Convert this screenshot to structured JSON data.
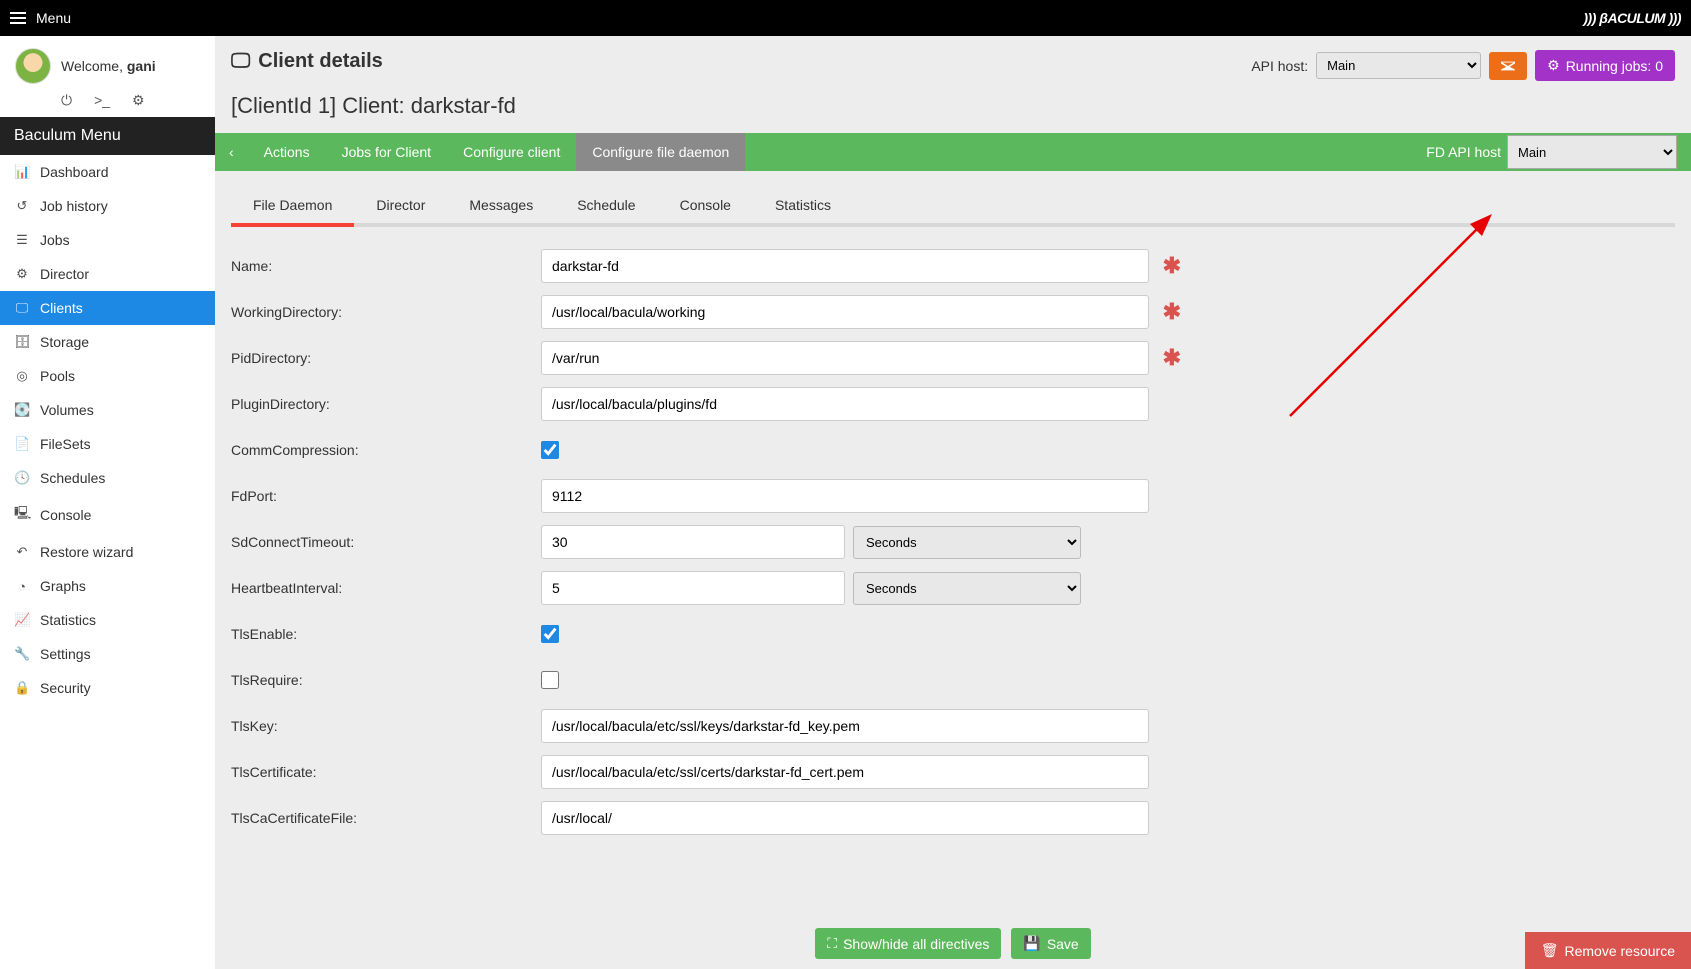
{
  "topbar": {
    "menu": "Menu",
    "brand": "))) βACULUM )))"
  },
  "user": {
    "welcome": "Welcome, ",
    "name": "gani"
  },
  "sidebar": {
    "header": "Baculum Menu",
    "items": [
      {
        "icon": "tach",
        "label": "Dashboard"
      },
      {
        "icon": "hist",
        "label": "Job history"
      },
      {
        "icon": "list",
        "label": "Jobs"
      },
      {
        "icon": "sitemap",
        "label": "Director"
      },
      {
        "icon": "desktop",
        "label": "Clients"
      },
      {
        "icon": "db",
        "label": "Storage"
      },
      {
        "icon": "tape",
        "label": "Pools"
      },
      {
        "icon": "hdd",
        "label": "Volumes"
      },
      {
        "icon": "file",
        "label": "FileSets"
      },
      {
        "icon": "clock",
        "label": "Schedules"
      },
      {
        "icon": "term",
        "label": "Console"
      },
      {
        "icon": "undo",
        "label": "Restore wizard"
      },
      {
        "icon": "pie",
        "label": "Graphs"
      },
      {
        "icon": "chart",
        "label": "Statistics"
      },
      {
        "icon": "wrench",
        "label": "Settings"
      },
      {
        "icon": "lock",
        "label": "Security"
      }
    ]
  },
  "header": {
    "title": "Client details",
    "api_host_label": "API host:",
    "api_host_value": "Main",
    "running_jobs_label": "Running jobs: ",
    "running_jobs_count": "0",
    "subtitle": "[ClientId 1] Client: darkstar-fd"
  },
  "tabs": {
    "items": [
      "Actions",
      "Jobs for Client",
      "Configure client",
      "Configure file daemon"
    ],
    "fd_api_label": "FD API host",
    "fd_api_value": "Main"
  },
  "subtabs": [
    "File Daemon",
    "Director",
    "Messages",
    "Schedule",
    "Console",
    "Statistics"
  ],
  "form": {
    "name": {
      "label": "Name:",
      "value": "darkstar-fd"
    },
    "workdir": {
      "label": "WorkingDirectory:",
      "value": "/usr/local/bacula/working"
    },
    "piddir": {
      "label": "PidDirectory:",
      "value": "/var/run"
    },
    "plugindir": {
      "label": "PluginDirectory:",
      "value": "/usr/local/bacula/plugins/fd"
    },
    "commcomp": {
      "label": "CommCompression:"
    },
    "fdport": {
      "label": "FdPort:",
      "value": "9112"
    },
    "sdtimeout": {
      "label": "SdConnectTimeout:",
      "value": "30",
      "unit": "Seconds"
    },
    "heartbeat": {
      "label": "HeartbeatInterval:",
      "value": "5",
      "unit": "Seconds"
    },
    "tlsenable": {
      "label": "TlsEnable:"
    },
    "tlsrequire": {
      "label": "TlsRequire:"
    },
    "tlskey": {
      "label": "TlsKey:",
      "value": "/usr/local/bacula/etc/ssl/keys/darkstar-fd_key.pem"
    },
    "tlscert": {
      "label": "TlsCertificate:",
      "value": "/usr/local/bacula/etc/ssl/certs/darkstar-fd_cert.pem"
    },
    "tlscacert": {
      "label": "TlsCaCertificateFile:",
      "value": "/usr/local/"
    }
  },
  "buttons": {
    "showhide": "Show/hide all directives",
    "save": "Save",
    "remove": "Remove resource"
  }
}
